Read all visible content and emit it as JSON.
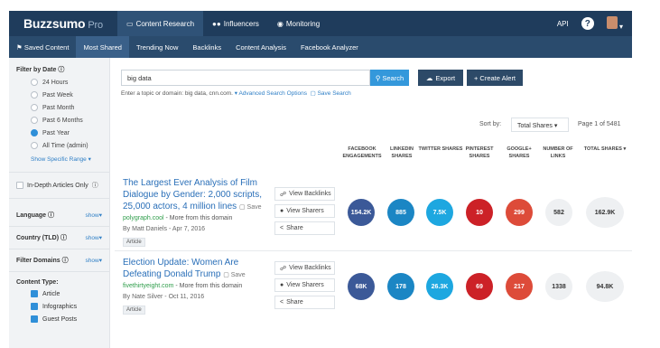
{
  "topbar": {
    "logo": "Buzzsumo",
    "logo_suffix": "Pro",
    "nav": [
      {
        "label": "Content Research",
        "icon": "monitor-icon"
      },
      {
        "label": "Influencers",
        "icon": "people-icon"
      },
      {
        "label": "Monitoring",
        "icon": "binoculars-icon"
      }
    ],
    "api_label": "API",
    "help_label": "?"
  },
  "subnav": [
    "Saved Content",
    "Most Shared",
    "Trending Now",
    "Backlinks",
    "Content Analysis",
    "Facebook Analyzer"
  ],
  "sidebar": {
    "filter_date_title": "Filter by Date",
    "date_options": [
      "24 Hours",
      "Past Week",
      "Past Month",
      "Past 6 Months",
      "Past Year",
      "All Time (admin)"
    ],
    "selected_date": "Past Year",
    "show_specific_range": "Show Specific Range",
    "in_depth_label": "In-Depth Articles Only",
    "dropdowns": [
      {
        "label": "Language",
        "show": "show"
      },
      {
        "label": "Country (TLD)",
        "show": "show"
      },
      {
        "label": "Filter Domains",
        "show": "show"
      }
    ],
    "content_type_title": "Content Type:",
    "content_types": [
      "Article",
      "Infographics",
      "Guest Posts"
    ]
  },
  "search": {
    "value": "big data",
    "button": "Search",
    "export": "Export",
    "create_alert": "+ Create Alert",
    "hint": "Enter a topic or domain: big data, cnn.com.",
    "advanced": "Advanced Search Options",
    "save_search": "Save Search"
  },
  "sort": {
    "label": "Sort by:",
    "value": "Total Shares",
    "page_info": "Page 1 of 5481"
  },
  "columns": [
    "FACEBOOK ENGAGEMENTS",
    "LINKEDIN SHARES",
    "TWITTER SHARES",
    "PINTEREST SHARES",
    "GOOGLE+ SHARES",
    "NUMBER OF LINKS",
    "TOTAL SHARES"
  ],
  "actions": {
    "backlinks": "View Backlinks",
    "sharers": "View Sharers",
    "share": "Share"
  },
  "results": [
    {
      "title": "The Largest Ever Analysis of Film Dialogue by Gender: 2,000 scripts, 25,000 actors, 4 million lines",
      "save": "Save",
      "domain": "polygraph.cool",
      "more": " - More from this domain",
      "byline": "By Matt Daniels - Apr 7, 2016",
      "tag": "Article",
      "stats": [
        "154.2K",
        "885",
        "7.5K",
        "10",
        "299",
        "582",
        "162.9K"
      ]
    },
    {
      "title": "Election Update: Women Are Defeating Donald Trump",
      "save": "Save",
      "domain": "fivethirtyeight.com",
      "more": " - More from this domain",
      "byline": "By Nate Silver - Oct 11, 2016",
      "tag": "Article",
      "stats": [
        "68K",
        "178",
        "26.3K",
        "69",
        "217",
        "1338",
        "94.8K"
      ]
    }
  ],
  "colors": {
    "facebook": "#3b5998",
    "linkedin": "#1b86c4",
    "twitter": "#1da7e0",
    "pinterest": "#cc2127",
    "google": "#dd4b39"
  }
}
